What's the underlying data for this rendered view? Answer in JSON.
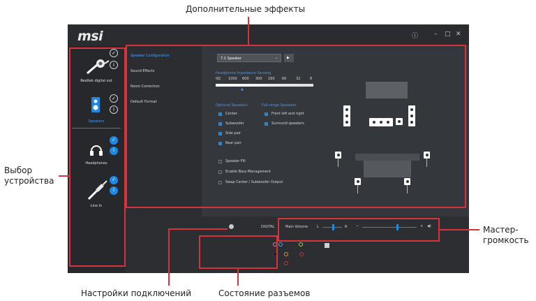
{
  "callouts": {
    "top": "Дополнительные эффекты",
    "left_line1": "Выбор",
    "left_line2": "устройства",
    "right_line1": "Мастер-",
    "right_line2": "громкость",
    "bottom_left": "Настройки подключений",
    "bottom_right": "Состояние разъемов"
  },
  "app": {
    "logo": "msi",
    "window_controls": {
      "info": "ⓘ",
      "minimize": "–",
      "maximize": "□",
      "close": "✕"
    },
    "devices": [
      {
        "label": "Realtek digital out",
        "icon": "digital-out-icon"
      },
      {
        "label": "Speakers",
        "icon": "speaker-icon",
        "selected": true
      },
      {
        "label": "Headphones",
        "icon": "headphones-icon"
      },
      {
        "label": "Line In",
        "icon": "line-in-icon"
      }
    ],
    "nav": [
      "Speaker Configuration",
      "Sound Effects",
      "Room Correction",
      "Default Format"
    ],
    "speaker_select": {
      "value": "7.1 Speaker",
      "play": "▶"
    },
    "impedance": {
      "title": "Headphone Impedance Sensing",
      "ticks": [
        "0Ω",
        "1000",
        "600",
        "300",
        "180",
        "60",
        "32",
        "8"
      ]
    },
    "optional_speakers": {
      "title": "Optional Speakers",
      "items": [
        {
          "label": "Center",
          "checked": true
        },
        {
          "label": "Subwoofer",
          "checked": true
        },
        {
          "label": "Side pair",
          "checked": true
        },
        {
          "label": "Rear pair",
          "checked": true
        }
      ]
    },
    "full_range": {
      "title": "Full-range Speakers",
      "items": [
        {
          "label": "Front left and right",
          "checked": true
        },
        {
          "label": "Surround speakers",
          "checked": true
        }
      ]
    },
    "options": [
      {
        "label": "Speaker Fill",
        "checked": false
      },
      {
        "label": "Enable Bass Management",
        "checked": false
      },
      {
        "label": "Swap Center / Subwoofer Output",
        "checked": false
      }
    ],
    "bottom": {
      "digital_label": "DIGITAL",
      "main_volume_label": "Main Volume",
      "balance_l": "L",
      "balance_r": "R",
      "vol_minus": "−",
      "vol_plus": "+",
      "speaker_glyph": "◀)",
      "balance_percent": 55,
      "volume_percent": 65
    },
    "colors": {
      "accent": "#1e88e5",
      "callout_red": "#d8323b"
    }
  }
}
